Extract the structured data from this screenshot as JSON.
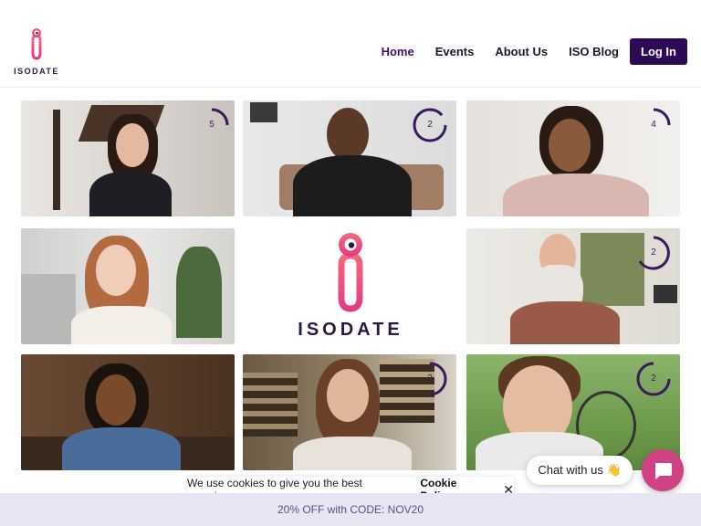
{
  "brand": {
    "name": "ISODATE",
    "color_primary": "#2d0a55",
    "color_accent": "#e6407a"
  },
  "nav": {
    "items": [
      "Home",
      "Events",
      "About Us",
      "ISO Blog"
    ],
    "active": "Home",
    "login_label": "Log In"
  },
  "grid": {
    "tiles": [
      {
        "timer": "5"
      },
      {
        "timer": "2"
      },
      {
        "timer": "4"
      },
      {
        "timer": ""
      },
      {
        "timer": "2"
      },
      {
        "timer": ""
      },
      {
        "timer": "2"
      },
      {
        "timer": "2"
      }
    ],
    "center_logo_text": "ISODATE"
  },
  "cookie": {
    "message": "We use cookies to give you the best experience.",
    "policy_link": "Cookie Policy",
    "close_icon": "close-icon"
  },
  "promo": {
    "text": "20% OFF with CODE: NOV20"
  },
  "chat": {
    "label": "Chat with us 👋",
    "icon": "chat-icon"
  }
}
